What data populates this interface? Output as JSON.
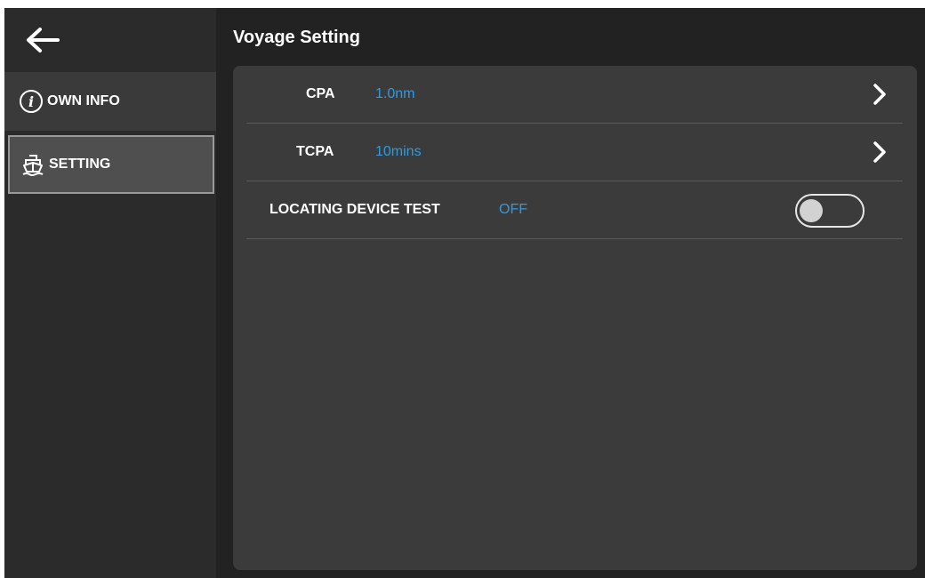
{
  "header": {
    "title": "Voyage Setting"
  },
  "sidebar": {
    "items": [
      {
        "label": "OWN INFO",
        "icon": "info-icon"
      },
      {
        "label": "SETTING",
        "icon": "ship-icon",
        "selected": true
      }
    ]
  },
  "settings": {
    "cpa": {
      "label": "CPA",
      "value": "1.0nm"
    },
    "tcpa": {
      "label": "TCPA",
      "value": "10mins"
    },
    "locating": {
      "label": "LOCATING DEVICE TEST",
      "value": "OFF",
      "toggle_on": false
    }
  },
  "colors": {
    "accent": "#2f9bdc",
    "background": "#222222",
    "panel": "#3b3b3b",
    "sidebar": "#2b2b2b"
  }
}
